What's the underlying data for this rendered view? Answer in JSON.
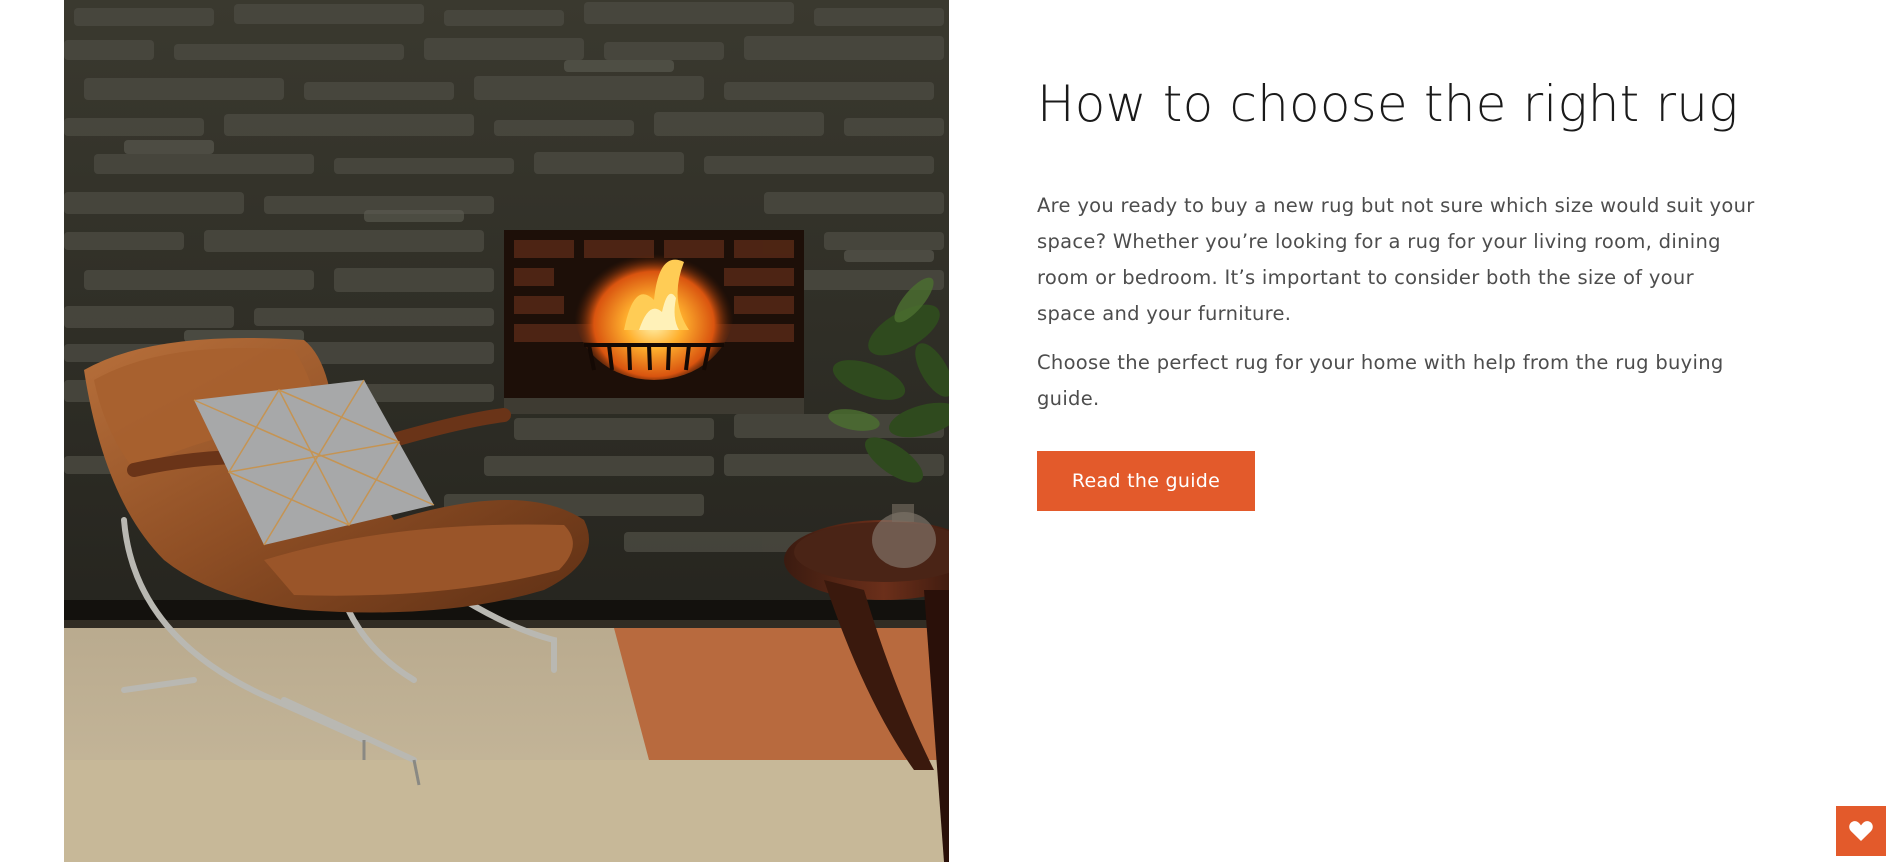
{
  "hero": {
    "alt": "Leather lounge chair beside a fireplace on a colour-block rug"
  },
  "content": {
    "title": "How to choose the right rug",
    "paragraph_1": "Are you ready to buy a new rug but not sure which size would suit your space? Whether you’re looking for a rug for your living room, dining room or bedroom. It’s important to consider both the size of your space and your furniture.",
    "paragraph_2": "Choose the perfect rug for your home with help from the rug buying guide.",
    "cta_label": "Read the guide"
  },
  "wishlist": {
    "icon": "heart-icon"
  },
  "colors": {
    "accent": "#e35a2b",
    "title_text": "#1a1a1a",
    "body_text": "#4d4d4d"
  }
}
